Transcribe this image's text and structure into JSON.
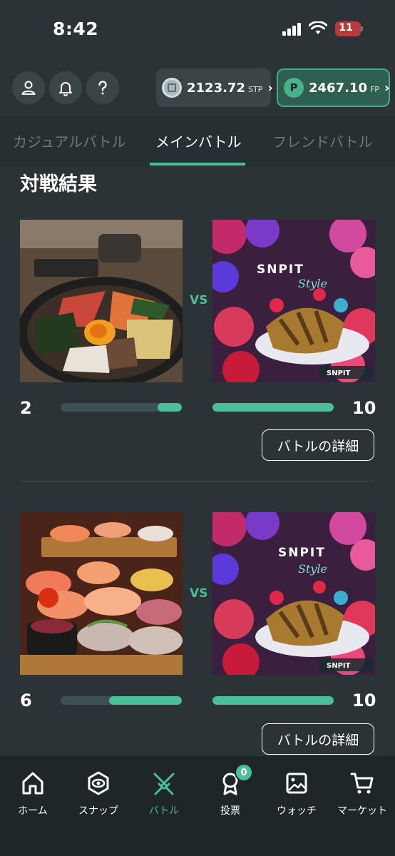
{
  "status_bar": {
    "time": "8:42",
    "battery": "11"
  },
  "header": {
    "stp": {
      "value": "2123.72",
      "unit": "STP"
    },
    "fp": {
      "value": "2467.10",
      "unit": "FP",
      "coin_letter": "P"
    }
  },
  "tabs": [
    {
      "label": "カジュアルバトル",
      "active": false
    },
    {
      "label": "メインバトル",
      "active": true
    },
    {
      "label": "フレンドバトル",
      "active": false
    }
  ],
  "section_title": "対戦結果",
  "battles": [
    {
      "left_photo": "bibimbap",
      "right_photo": "snpit-cake",
      "vs_label": "VS",
      "left_score": "2",
      "right_score": "10",
      "left_ratio": 0.2,
      "right_ratio": 1.0,
      "detail_label": "バトルの詳細"
    },
    {
      "left_photo": "sushi",
      "right_photo": "snpit-cake",
      "vs_label": "VS",
      "left_score": "6",
      "right_score": "10",
      "left_ratio": 0.6,
      "right_ratio": 1.0,
      "detail_label": "バトルの詳細"
    }
  ],
  "bottom_nav": [
    {
      "label": "ホーム",
      "icon": "home-icon"
    },
    {
      "label": "スナップ",
      "icon": "camera-icon"
    },
    {
      "label": "バトル",
      "icon": "swords-icon",
      "active": true
    },
    {
      "label": "投票",
      "icon": "medal-icon",
      "badge": "0"
    },
    {
      "label": "ウォッチ",
      "icon": "image-icon"
    },
    {
      "label": "マーケット",
      "icon": "cart-icon"
    }
  ],
  "colors": {
    "accent": "#4bbf98",
    "background": "#2b3336",
    "nav": "#1f2628"
  }
}
